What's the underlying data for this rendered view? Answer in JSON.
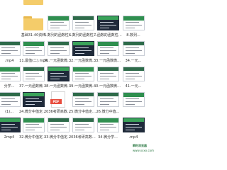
{
  "rows": [
    [
      {
        "kind": "empty",
        "caption": ""
      },
      {
        "kind": "folder",
        "caption": ""
      },
      {
        "kind": "empty",
        "caption": ""
      },
      {
        "kind": "empty",
        "caption": ""
      },
      {
        "kind": "empty",
        "caption": ""
      },
      {
        "kind": "empty",
        "caption": ""
      }
    ],
    [
      {
        "kind": "empty",
        "caption": ""
      },
      {
        "kind": "folder",
        "caption": "基础31-40资料"
      },
      {
        "kind": "video",
        "caption": "5.数列的函数性质..."
      },
      {
        "kind": "video",
        "caption": "6.数列的函数性质..."
      },
      {
        "kind": "video",
        "caption": "7.函数的函数性质..."
      },
      {
        "kind": "video",
        "caption": "8.数列..."
      }
    ],
    [
      {
        "kind": "video",
        "caption": ".mp4"
      },
      {
        "kind": "video",
        "caption": "11.最值(二).mp4"
      },
      {
        "kind": "video",
        "caption": "31.一元函数微分学..."
      },
      {
        "kind": "video",
        "caption": "32.一元函数微分学..."
      },
      {
        "kind": "video",
        "caption": "33.一元函数微分学..."
      },
      {
        "kind": "video",
        "caption": "34.一元..."
      }
    ],
    [
      {
        "kind": "video",
        "caption": "分学..."
      },
      {
        "kind": "video",
        "caption": "37.一元函数微分学..."
      },
      {
        "kind": "video",
        "caption": "38.一元函数微分学..."
      },
      {
        "kind": "video",
        "caption": "39.一元函数微分学..."
      },
      {
        "kind": "video",
        "caption": "40.一元函数微分学..."
      },
      {
        "kind": "video",
        "caption": "41.一元..."
      }
    ],
    [
      {
        "kind": "video",
        "caption": "(1)..."
      },
      {
        "kind": "video",
        "caption": "24.微分中值定理(2)..."
      },
      {
        "kind": "pdf",
        "caption": "2036考研高数基础..."
      },
      {
        "kind": "video",
        "caption": "25.微分中值定理(2)..."
      },
      {
        "kind": "video",
        "caption": "26.微分中值..."
      },
      {
        "kind": "video",
        "caption": ""
      }
    ],
    [
      {
        "kind": "video",
        "caption": "2mp4"
      },
      {
        "kind": "video",
        "caption": "32.微分中值定理(1)..."
      },
      {
        "kind": "video",
        "caption": "33.微分中值定理(2)..."
      },
      {
        "kind": "video",
        "caption": "2036考研高数基础..."
      },
      {
        "kind": "video",
        "caption": "34.微分学..."
      },
      {
        "kind": "video",
        "caption": ".mp4"
      }
    ]
  ],
  "pdf_label": "PDF",
  "watermark": {
    "line1": "瞬时浏览器",
    "line2": "www.xxxx.com"
  }
}
